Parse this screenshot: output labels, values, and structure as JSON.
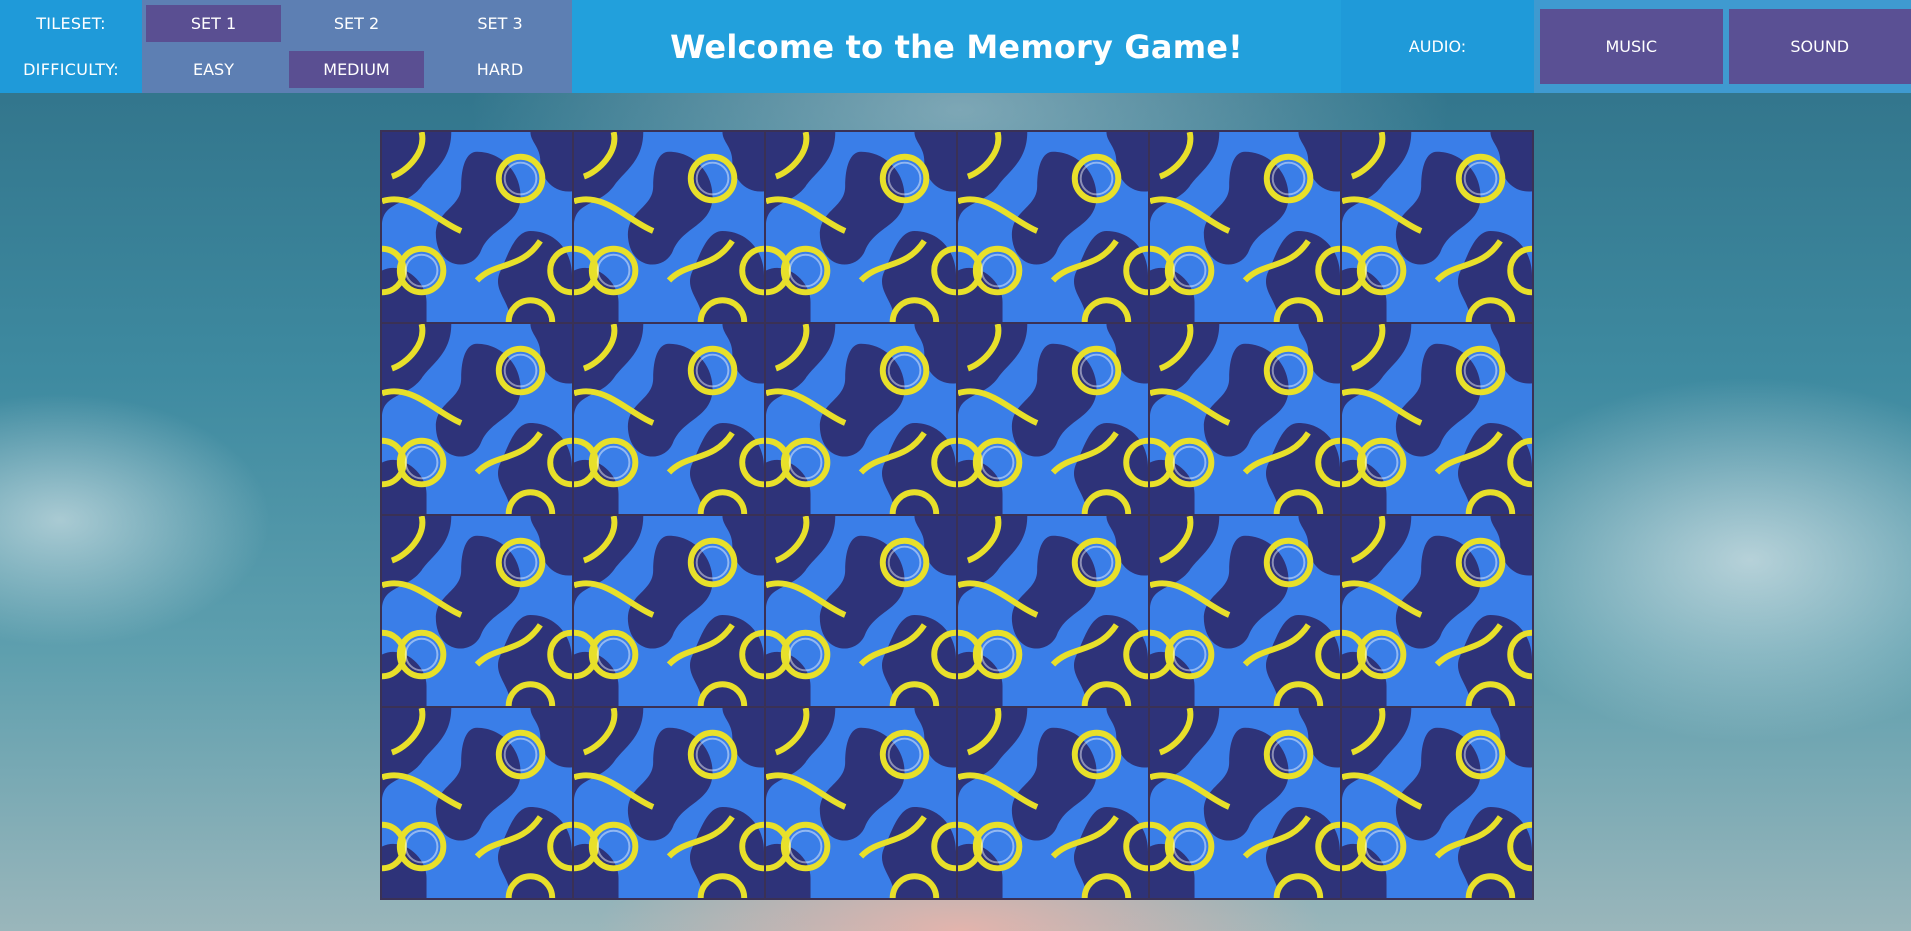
{
  "header": {
    "title": "Welcome to the Memory Game!",
    "tileset_label": "TILESET:",
    "difficulty_label": "DIFFICULTY:",
    "audio_label": "AUDIO:"
  },
  "tileset_options": [
    {
      "label": "SET 1",
      "selected": true
    },
    {
      "label": "SET 2",
      "selected": false
    },
    {
      "label": "SET 3",
      "selected": false
    }
  ],
  "difficulty_options": [
    {
      "label": "EASY",
      "selected": false
    },
    {
      "label": "MEDIUM",
      "selected": true
    },
    {
      "label": "HARD",
      "selected": false
    }
  ],
  "audio_buttons": [
    {
      "label": "MUSIC"
    },
    {
      "label": "SOUND"
    }
  ],
  "board": {
    "columns": 6,
    "rows": 4,
    "tile_state": "face-down",
    "tile_pattern_icon": "truchet-swirl-pattern-icon"
  },
  "colors": {
    "header_blue": "#22a0dc",
    "label_blue": "#1f9ad9",
    "panel_blue": "#5d7fb3",
    "selected_purple": "#5a4f92",
    "tile_light_blue": "#3a7ee8",
    "tile_dark_navy": "#2e3379",
    "tile_ring_yellow": "#e8e02a"
  }
}
